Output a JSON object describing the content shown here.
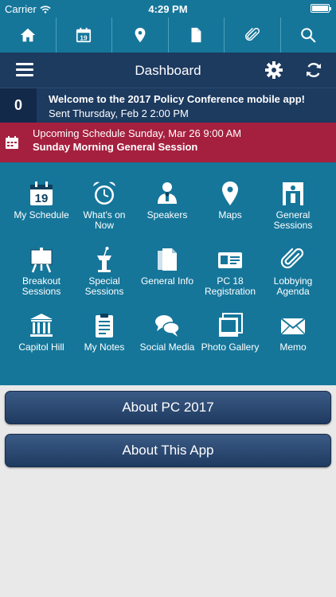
{
  "status_bar": {
    "carrier": "Carrier",
    "time": "4:29 PM"
  },
  "toolbar": {
    "icons": [
      "home-icon",
      "calendar-icon",
      "map-pin-icon",
      "document-icon",
      "paperclip-icon",
      "search-icon"
    ],
    "calendar_day": "19"
  },
  "navbar": {
    "title": "Dashboard"
  },
  "message": {
    "count": "0",
    "title": "Welcome to the 2017 Policy Conference mobile app!",
    "sent": "Sent Thursday, Feb 2 2:00 PM"
  },
  "upcoming": {
    "line1": "Upcoming Schedule Sunday, Mar 26 9:00 AM",
    "line2": "Sunday Morning General Session"
  },
  "grid": {
    "items": [
      {
        "label": "My Schedule",
        "icon": "calendar-icon"
      },
      {
        "label": "What's on Now",
        "icon": "alarm-clock-icon"
      },
      {
        "label": "Speakers",
        "icon": "speaker-icon"
      },
      {
        "label": "Maps",
        "icon": "map-pin-icon"
      },
      {
        "label": "General Sessions",
        "icon": "session-room-icon"
      },
      {
        "label": "Breakout Sessions",
        "icon": "easel-icon"
      },
      {
        "label": "Special Sessions",
        "icon": "podium-icon"
      },
      {
        "label": "General Info",
        "icon": "documents-icon"
      },
      {
        "label": "PC 18 Registration",
        "icon": "id-card-icon"
      },
      {
        "label": "Lobbying Agenda",
        "icon": "paperclip-icon"
      },
      {
        "label": "Capitol Hill",
        "icon": "capitol-building-icon"
      },
      {
        "label": "My Notes",
        "icon": "clipboard-icon"
      },
      {
        "label": "Social Media",
        "icon": "chat-bubbles-icon"
      },
      {
        "label": "Photo Gallery",
        "icon": "photo-stack-icon"
      },
      {
        "label": "Memo",
        "icon": "envelope-icon"
      }
    ]
  },
  "buttons": {
    "about_pc": "About PC 2017",
    "about_app": "About This App"
  },
  "colors": {
    "toolbar": "#15769a",
    "navbar": "#1d3a5f",
    "upcoming": "#a5203f",
    "grid": "#15769a",
    "background": "#e9e9e9"
  }
}
